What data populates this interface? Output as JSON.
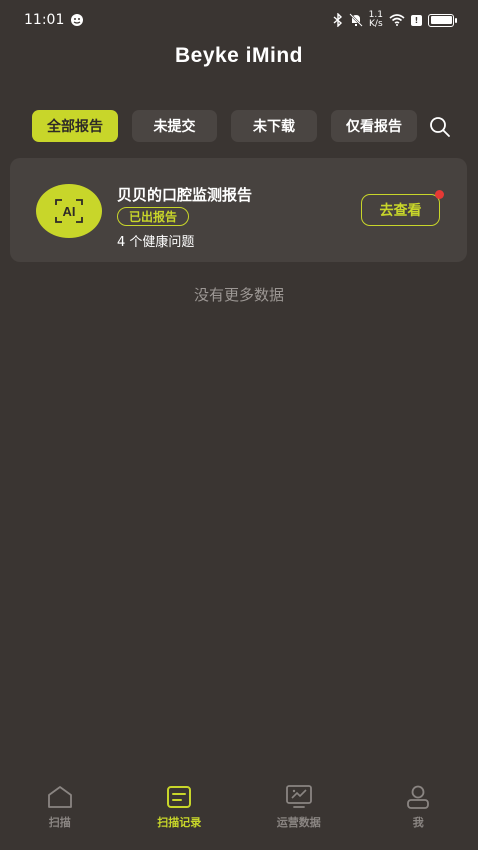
{
  "status_bar": {
    "time": "11:01",
    "speed_value": "1.1",
    "speed_unit": "K/s",
    "notif_count": "!"
  },
  "header": {
    "title": "Beyke iMind"
  },
  "tabs": [
    {
      "label": "全部报告",
      "active": true
    },
    {
      "label": "未提交",
      "active": false
    },
    {
      "label": "未下载",
      "active": false
    },
    {
      "label": "仅看报告",
      "active": false
    }
  ],
  "report_card": {
    "avatar_text": "AI",
    "title": "贝贝的口腔监测报告",
    "status": "已出报告",
    "issues": "4 个健康问题",
    "action_label": "去查看"
  },
  "list_footer": "没有更多数据",
  "bottom_nav": [
    {
      "label": "扫描",
      "icon": "home-icon",
      "active": false
    },
    {
      "label": "扫描记录",
      "icon": "record-icon",
      "active": true
    },
    {
      "label": "运营数据",
      "icon": "monitor-chart-icon",
      "active": false
    },
    {
      "label": "我",
      "icon": "user-icon",
      "active": false
    }
  ],
  "colors": {
    "background": "#3a3532",
    "accent": "#c8d62a",
    "card": "#47423f",
    "badge_dot": "#e53935"
  }
}
